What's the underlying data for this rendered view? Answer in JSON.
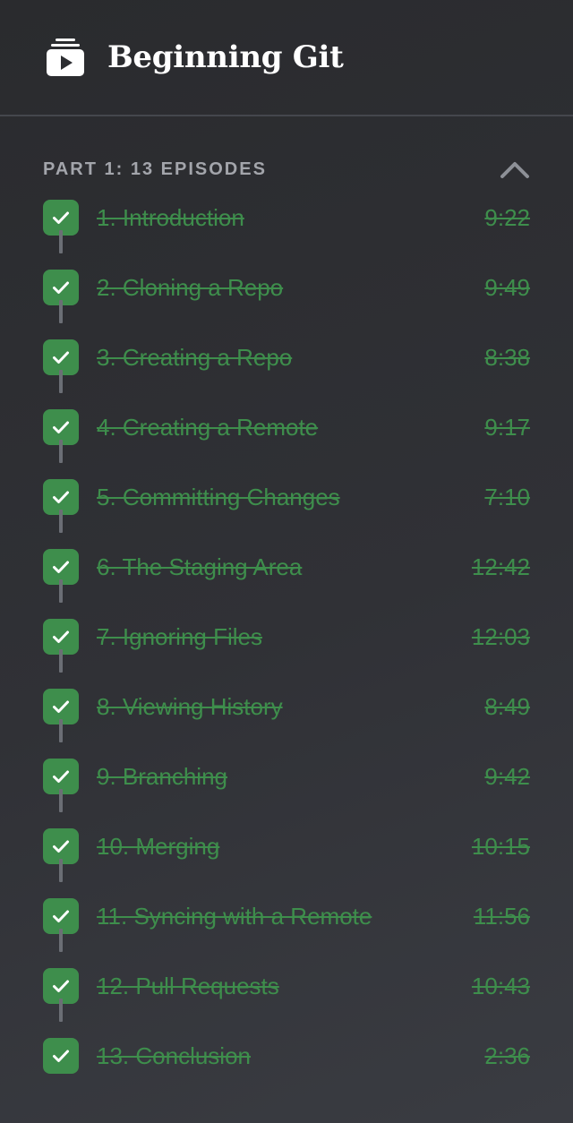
{
  "course": {
    "title": "Beginning Git",
    "icon": "video-playlist-icon"
  },
  "part": {
    "title": "PART 1: 13 EPISODES",
    "toggle_icon": "chevron-up-icon"
  },
  "colors": {
    "completed": "#3e8e4c",
    "connector": "#6b6e75",
    "part_title": "#a3a5ab"
  },
  "episodes": [
    {
      "title": "1. Introduction",
      "duration": "9:22"
    },
    {
      "title": "2. Cloning a Repo",
      "duration": "9:49"
    },
    {
      "title": "3. Creating a Repo",
      "duration": "8:38"
    },
    {
      "title": "4. Creating a Remote",
      "duration": "9:17"
    },
    {
      "title": "5. Committing Changes",
      "duration": "7:10"
    },
    {
      "title": "6. The Staging Area",
      "duration": "12:42"
    },
    {
      "title": "7. Ignoring Files",
      "duration": "12:03"
    },
    {
      "title": "8. Viewing History",
      "duration": "8:49"
    },
    {
      "title": "9. Branching",
      "duration": "9:42"
    },
    {
      "title": "10. Merging",
      "duration": "10:15"
    },
    {
      "title": "11. Syncing with a Remote",
      "duration": "11:56"
    },
    {
      "title": "12. Pull Requests",
      "duration": "10:43"
    },
    {
      "title": "13. Conclusion",
      "duration": "2:36"
    }
  ]
}
